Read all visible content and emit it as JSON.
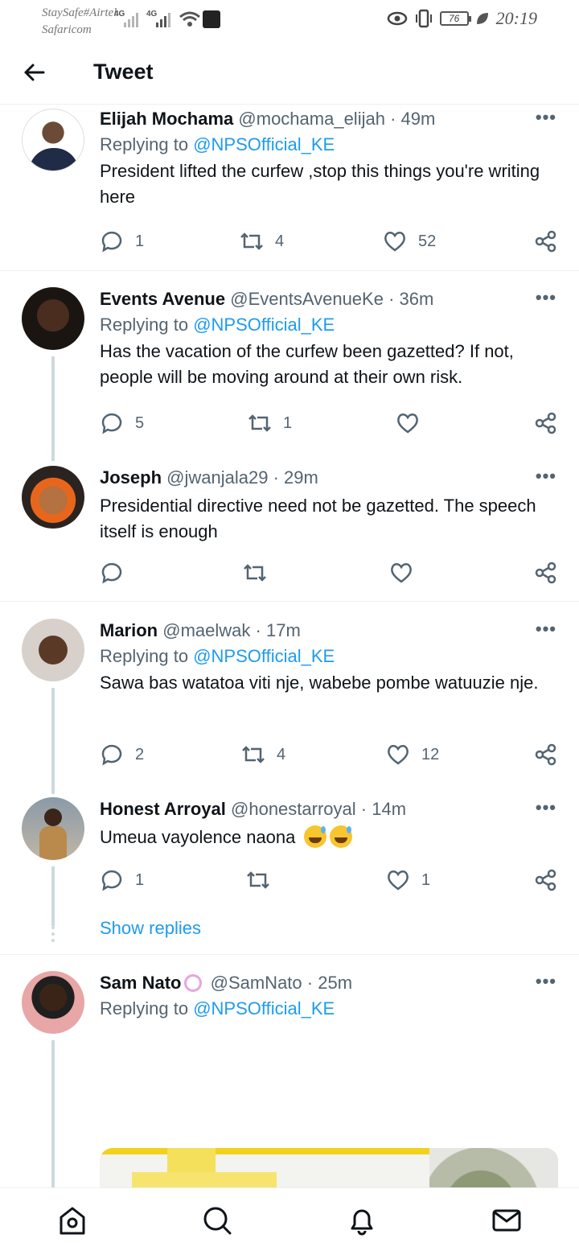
{
  "status_bar": {
    "carrier_line1": "StaySafe#Airtel",
    "carrier_line2": "Safaricom",
    "net1": "4G",
    "net2": "4G",
    "battery": "76",
    "time": "20:19"
  },
  "header": {
    "title": "Tweet",
    "back_icon": "arrow-left-icon"
  },
  "tweets": [
    {
      "name": "Elijah Mochama",
      "handle": "@mochama_elijah",
      "time": "49m",
      "replying_label": "Replying to",
      "replying_to": "@NPSOfficial_KE",
      "text": "President lifted the curfew ,stop this things you're writing here",
      "replies": "1",
      "retweets": "4",
      "likes": "52"
    },
    {
      "name": "Events Avenue",
      "handle": "@EventsAvenueKe",
      "time": "36m",
      "replying_label": "Replying to",
      "replying_to": "@NPSOfficial_KE",
      "text": "Has the vacation of the curfew been gazetted? If not, people will be moving around at their own risk.",
      "replies": "5",
      "retweets": "1",
      "likes": ""
    },
    {
      "name": "Joseph",
      "handle": "@jwanjala29",
      "time": "29m",
      "text": "Presidential directive need not be gazetted. The speech itself is enough",
      "replies": "",
      "retweets": "",
      "likes": ""
    },
    {
      "name": "Marion",
      "handle": "@maelwak",
      "time": "17m",
      "replying_label": "Replying to",
      "replying_to": "@NPSOfficial_KE",
      "text": "Sawa bas watatoa viti nje, wabebe pombe watuuzie nje.",
      "replies": "2",
      "retweets": "4",
      "likes": "12"
    },
    {
      "name": "Honest Arroyal",
      "handle": "@honestarroyal",
      "time": "14m",
      "text": "Umeua vayolence naona",
      "replies": "1",
      "retweets": "",
      "likes": "1",
      "show_replies": "Show replies"
    },
    {
      "name": "Sam Nato",
      "handle": "@SamNato",
      "time": "25m",
      "replying_label": "Replying to",
      "replying_to": "@NPSOfficial_KE"
    }
  ],
  "common": {
    "dot": "·",
    "more": "•••"
  },
  "bottom_nav": [
    "home-icon",
    "search-icon",
    "notifications-icon",
    "messages-icon"
  ],
  "colors": {
    "accent": "#1d9bf0",
    "text": "#0f1419",
    "muted": "#536471",
    "thread": "#cfd9de"
  }
}
